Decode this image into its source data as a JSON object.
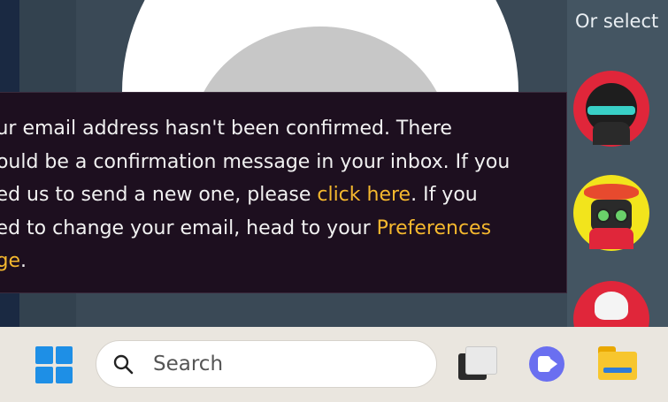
{
  "header": {
    "or_select": "Or select"
  },
  "notice": {
    "line1": "our email address hasn't been confirmed. There",
    "line2": "hould be a confirmation message in your inbox. If you",
    "line3_pre": "eed us to send a new one, please ",
    "line3_link": "click here",
    "line3_post": ". If you",
    "line4_pre": "eed to change your email, head to your ",
    "line4_link": "Preferences",
    "line5_link": "age",
    "line5_post": "."
  },
  "taskbar": {
    "search_label": "Search",
    "icons": [
      "windows-start-icon",
      "search-icon",
      "task-view-icon",
      "teams-chat-icon",
      "file-explorer-icon"
    ]
  },
  "colors": {
    "notice_bg": "#1d0f1f",
    "link": "#f5b82e",
    "taskbar_bg": "#eae6df"
  }
}
